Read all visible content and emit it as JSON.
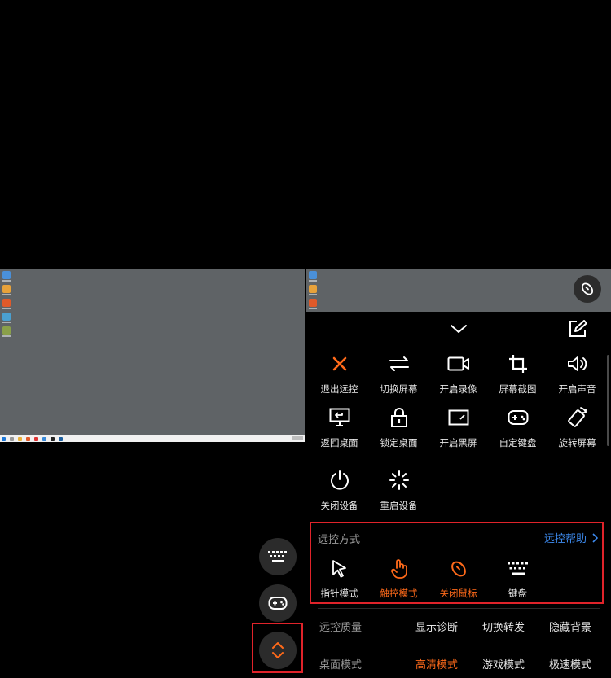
{
  "colors": {
    "accent": "#ff6a1a",
    "link": "#3d8bf0",
    "highlight": "#e0232a",
    "desktop_bg": "#5f6366"
  },
  "left": {
    "fab_keyboard_icon": "keyboard-icon",
    "fab_gamepad_icon": "gamepad-icon",
    "fab_toggle_icon": "expand-collapse-icon"
  },
  "toolbar": {
    "collapse_icon": "chevron-down-icon",
    "edit_icon": "edit-icon",
    "items": [
      {
        "label": "退出远控",
        "icon": "close-icon"
      },
      {
        "label": "切换屏幕",
        "icon": "swap-icon"
      },
      {
        "label": "开启录像",
        "icon": "video-camera-icon"
      },
      {
        "label": "屏幕截图",
        "icon": "crop-icon"
      },
      {
        "label": "开启声音",
        "icon": "speaker-icon"
      },
      {
        "label": "返回桌面",
        "icon": "monitor-return-icon"
      },
      {
        "label": "锁定桌面",
        "icon": "lock-icon"
      },
      {
        "label": "开启黑屏",
        "icon": "black-screen-icon"
      },
      {
        "label": "自定键盘",
        "icon": "gamepad-icon"
      },
      {
        "label": "旋转屏幕",
        "icon": "rotate-icon"
      },
      {
        "label": "关闭设备",
        "icon": "power-icon"
      },
      {
        "label": "重启设备",
        "icon": "restart-icon"
      }
    ]
  },
  "control_mode": {
    "title": "远控方式",
    "help_label": "远控帮助",
    "options": [
      {
        "label": "指针模式",
        "icon": "pointer-icon",
        "active": false
      },
      {
        "label": "触控模式",
        "icon": "touch-icon",
        "active": true
      },
      {
        "label": "关闭鼠标",
        "icon": "mouse-icon",
        "active": true
      },
      {
        "label": "键盘",
        "icon": "keyboard-icon",
        "active": false
      }
    ]
  },
  "quality": {
    "title": "远控质量",
    "options": [
      "显示诊断",
      "切换转发",
      "隐藏背景"
    ]
  },
  "desktop_mode": {
    "title": "桌面模式",
    "options": [
      "高清模式",
      "游戏模式",
      "极速模式"
    ],
    "active_index": 0
  }
}
